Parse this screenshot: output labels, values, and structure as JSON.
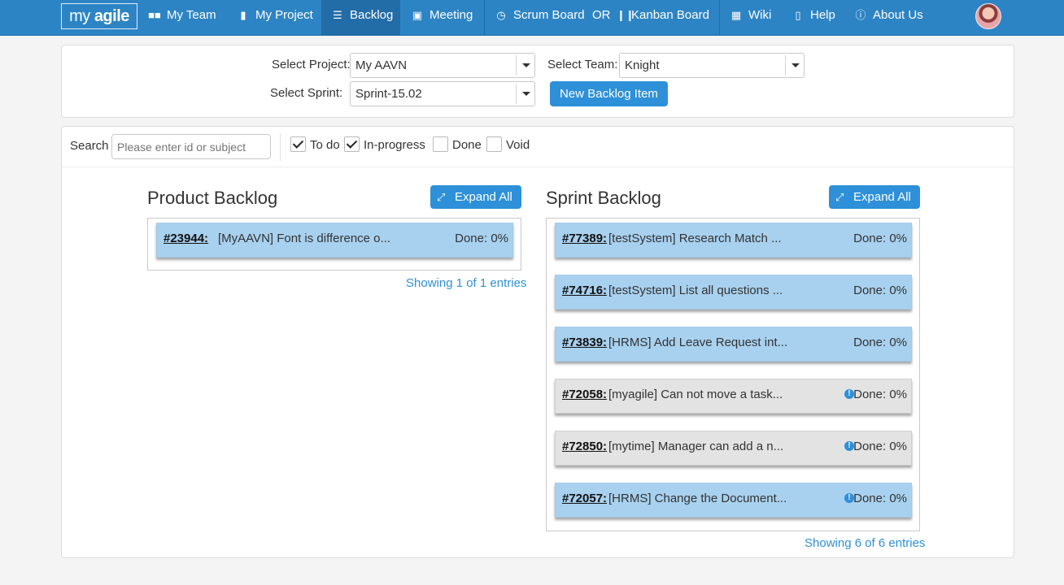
{
  "nav": {
    "logo_my": "my ",
    "logo_agile": "agile",
    "my_team": "My Team",
    "my_project": "My Project",
    "backlog": "Backlog",
    "meeting": "Meeting",
    "scrum_board": "Scrum Board",
    "or": "OR",
    "kanban_board": "Kanban Board",
    "wiki": "Wiki",
    "help": "Help",
    "about_us": "About Us"
  },
  "filters": {
    "project_label": "Select Project:",
    "project_value": "My AAVN",
    "team_label": "Select Team:",
    "team_value": "Knight",
    "sprint_label": "Select Sprint:",
    "sprint_value": "Sprint-15.02",
    "new_item_button": "New Backlog Item"
  },
  "search": {
    "label": "Search",
    "placeholder": "Please enter id or subject",
    "statuses": [
      {
        "label": "To do",
        "checked": true
      },
      {
        "label": "In-progress",
        "checked": true
      },
      {
        "label": "Done",
        "checked": false
      },
      {
        "label": "Void",
        "checked": false
      }
    ]
  },
  "product_backlog": {
    "title": "Product Backlog",
    "expand_label": "Expand All",
    "items": [
      {
        "id": "#23944:",
        "subject": "[MyAAVN] Font is difference o...",
        "done": "Done: 0%",
        "color": "blue",
        "warning": false
      }
    ],
    "showing": "Showing 1 of 1 entries"
  },
  "sprint_backlog": {
    "title": "Sprint Backlog",
    "expand_label": "Expand All",
    "items": [
      {
        "id": "#77389:",
        "subject": "[testSystem] Research Match ...",
        "done": "Done: 0%",
        "color": "blue",
        "warning": false
      },
      {
        "id": "#74716:",
        "subject": "[testSystem] List all questions ...",
        "done": "Done: 0%",
        "color": "blue",
        "warning": false
      },
      {
        "id": "#73839:",
        "subject": "[HRMS] Add Leave Request int...",
        "done": "Done: 0%",
        "color": "blue",
        "warning": false
      },
      {
        "id": "#72058:",
        "subject": "[myagile] Can not move a task...",
        "done": "Done: 0%",
        "color": "gray",
        "warning": true
      },
      {
        "id": "#72850:",
        "subject": "[mytime] Manager can add a n...",
        "done": "Done: 0%",
        "color": "gray",
        "warning": true
      },
      {
        "id": "#72057:",
        "subject": "[HRMS] Change the Document...",
        "done": "Done: 0%",
        "color": "blue",
        "warning": true
      }
    ],
    "showing": "Showing 6 of 6 entries"
  },
  "colors": {
    "navbar": "#2d84c4",
    "accent": "#2d90d9",
    "card_blue": "#a8d1ef",
    "card_gray": "#e3e3e3"
  }
}
